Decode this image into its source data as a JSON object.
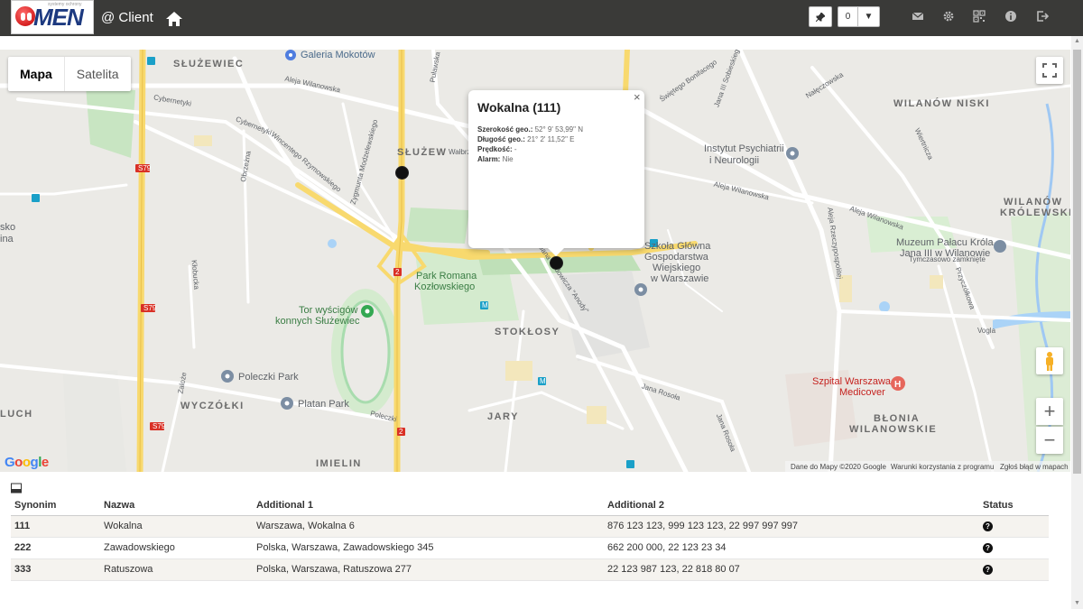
{
  "header": {
    "logo_text": "MEN",
    "logo_tagline": "systemy ochrony",
    "client_label": "@ Client",
    "counter_value": "0",
    "caret": "▼",
    "icons": [
      "pin-icon",
      "mail-icon",
      "gear-icon",
      "qr-code-icon",
      "info-icon",
      "logout-icon"
    ]
  },
  "map": {
    "type_buttons": [
      "Mapa",
      "Satelita"
    ],
    "labels": {
      "sluzewiec": "SŁUŻEWIEC",
      "galeria": "Galeria Mokotów",
      "sluzew": "SŁUŻEW",
      "walbrzyska": "Wałbrz",
      "wilanow_niski": "WILANÓW NISKI",
      "instytut1": "Instytut Psychiatrii",
      "instytut2": "i Neurologii",
      "wilanow_krol1": "WILANÓW",
      "wilanow_krol2": "KRÓLEWSKI",
      "muzeum1": "Muzeum Pałacu Króla",
      "muzeum2": "Jana III w Wilanowie",
      "muzeum3": "Tymczasowo zamknięte",
      "sggw1": "Szkoła Główna",
      "sggw2": "Gospodarstwa",
      "sggw3": "Wiejskiego",
      "sggw4": "w Warszawie",
      "park1": "Park Romana",
      "park2": "Kozłowskiego",
      "tor1": "Tor wyścigów",
      "tor2": "konnych Służewiec",
      "stoklosy": "STOKŁOSY",
      "poleczki_park": "Poleczki Park",
      "wyczolki": "WYCZÓŁKI",
      "platan": "Platan Park",
      "jary": "JARY",
      "szpital1": "Szpital Warszawa",
      "szpital2": "Medicover",
      "blonia1": "BŁONIA",
      "blonia2": "WILANOWSKIE",
      "imielin": "IMIELIN",
      "luch": "LUCH",
      "sko1": "sko",
      "sko2": "ina",
      "al_wilanowska": "Aleja Wilanowska",
      "cybernetyki": "Cybernetyki",
      "cybernetyki2": "Cybernetyki",
      "woronicza": "Wincentego Rzymowskiego",
      "modzelewskiego": "Zygmunta Modzelewskiego",
      "obrzezna": "Obrzeżna",
      "klobucka": "Kłobucka",
      "zaloze": "Zaloże",
      "poleczki": "Poleczki",
      "rosola": "Jana Rosoła",
      "rosola2": "Jana Rosoła",
      "vogla": "Vogla",
      "przyczolkowa": "Przyczółkowa",
      "rzeczypospolitej": "Aleja Rzeczypospolitej",
      "nalęczowska": "Nałęczowska",
      "wiertnicza": "Wiertnicza",
      "sobieskiego": "Jana III Sobieskiego",
      "bonifacego": "Świętego Bonifacego",
      "pulawska": "Puławska",
      "rodowicza": "Jana Rodowicza \"Anody\"",
      "s79": "S79",
      "n2": "2",
      "m": "M"
    },
    "popup": {
      "title": "Wokalna (111)",
      "close": "×",
      "rows": [
        {
          "label": "Szerokość geo.:",
          "value": "52° 9' 53,99\" N"
        },
        {
          "label": "Długość geo.:",
          "value": "21° 2' 11,52\" E"
        },
        {
          "label": "Prędkość:",
          "value": "-"
        },
        {
          "label": "Alarm:",
          "value": "Nie"
        }
      ]
    },
    "google": "Google",
    "attribution": [
      "Dane do Mapy ©2020 Google",
      "Warunki korzystania z programu",
      "Zgłoś błąd w mapach"
    ],
    "zoom_in": "+",
    "zoom_out": "−"
  },
  "table": {
    "columns": [
      "Synonim",
      "Nazwa",
      "Additional 1",
      "Additional 2",
      "Status"
    ],
    "rows": [
      {
        "synonim": "111",
        "nazwa": "Wokalna",
        "add1": "Warszawa, Wokalna 6",
        "add2": "876 123 123, 999 123 123, 22 997 997 997",
        "status": "?"
      },
      {
        "synonim": "222",
        "nazwa": "Zawadowskiego",
        "add1": "Polska, Warszawa, Zawadowskiego 345",
        "add2": "662 200 000, 22 123 23 34",
        "status": "?"
      },
      {
        "synonim": "333",
        "nazwa": "Ratuszowa",
        "add1": "Polska, Warszawa, Ratuszowa 277",
        "add2": "22 123 987 123, 22 818 80 07",
        "status": "?"
      }
    ]
  }
}
